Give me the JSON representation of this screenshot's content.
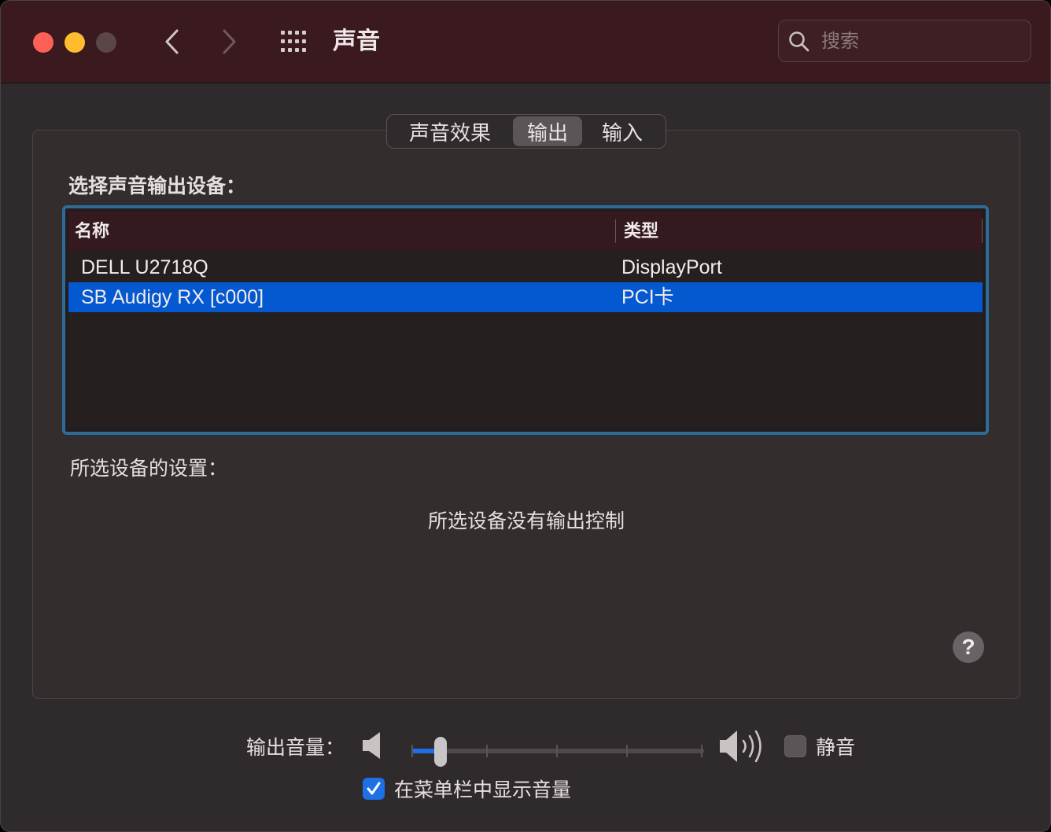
{
  "window": {
    "title": "声音",
    "search_placeholder": "搜索"
  },
  "icons": {
    "back": "chevron-left-icon",
    "forward": "chevron-right-icon",
    "grid": "grid-icon",
    "search": "search-icon",
    "help": "help-icon",
    "speaker_low": "speaker-low-icon",
    "speaker_high": "speaker-high-icon",
    "checkmark": "checkmark-icon"
  },
  "tabs": [
    {
      "label": "声音效果",
      "selected": false
    },
    {
      "label": "输出",
      "selected": true
    },
    {
      "label": "输入",
      "selected": false
    }
  ],
  "output": {
    "choose_label": "选择声音输出设备：",
    "columns": [
      "名称",
      "类型"
    ],
    "devices": [
      {
        "name": "DELL U2718Q",
        "type": "DisplayPort",
        "selected": false
      },
      {
        "name": "SB Audigy RX [c000]",
        "type": "PCI卡",
        "selected": true
      }
    ],
    "settings_label": "所选设备的设置：",
    "no_control_message": "所选设备没有输出控制"
  },
  "volume": {
    "label": "输出音量：",
    "level": 0.1,
    "mute_label": "静音",
    "muted": false,
    "show_in_menu_bar_label": "在菜单栏中显示音量",
    "show_in_menu_bar": true
  },
  "help_label": "?",
  "colors": {
    "titlebar": "#3a1a1f",
    "window_bg": "#2f2a2b",
    "selection": "#0458d0",
    "accent": "#1e6ee8",
    "focus_ring": "#2f6b97",
    "close": "#fe5f57",
    "minimize": "#febc2e"
  }
}
